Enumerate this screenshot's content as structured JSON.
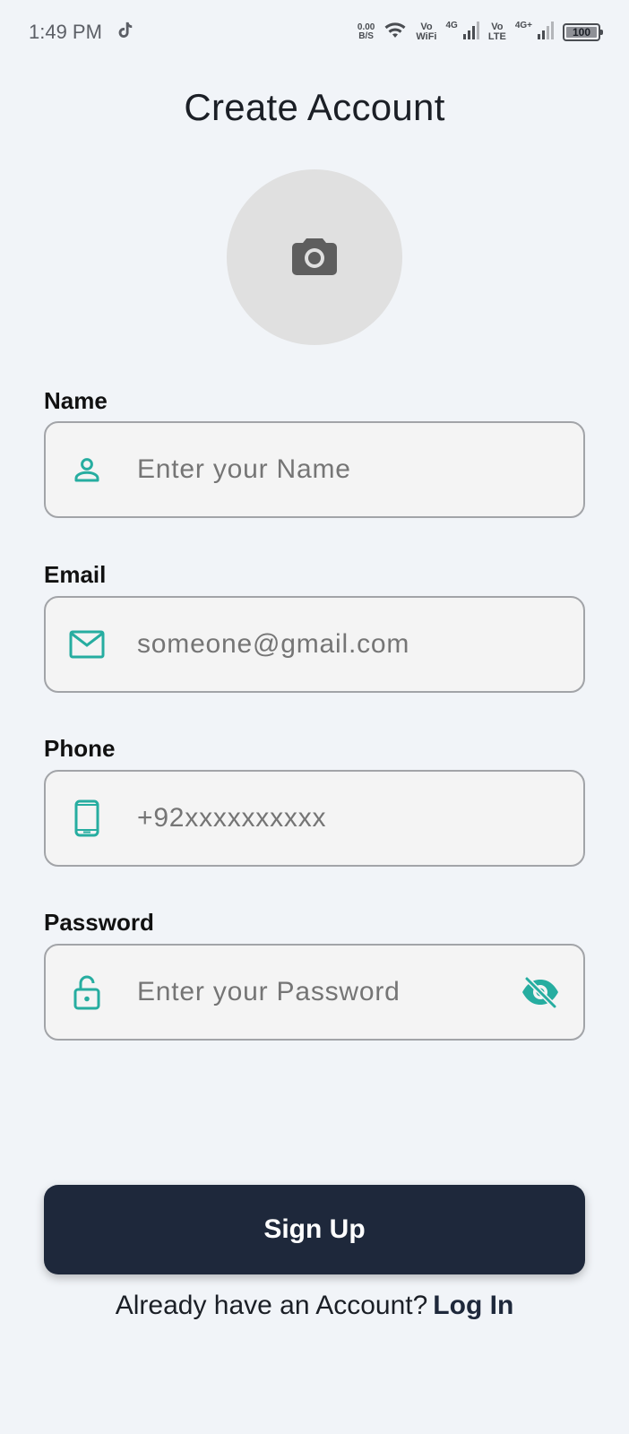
{
  "status_bar": {
    "time": "1:49 PM",
    "data_rate_value": "0.00",
    "data_rate_unit": "B/S",
    "vowifi_top": "Vo",
    "vowifi_bottom": "WiFi",
    "net1": "4G",
    "volte_top": "Vo",
    "volte_bottom": "LTE",
    "net2": "4G+",
    "battery": "100"
  },
  "page": {
    "title": "Create Account"
  },
  "fields": {
    "name": {
      "label": "Name",
      "placeholder": "Enter your Name"
    },
    "email": {
      "label": "Email",
      "placeholder": "someone@gmail.com"
    },
    "phone": {
      "label": "Phone",
      "placeholder": "+92xxxxxxxxxx"
    },
    "password": {
      "label": "Password",
      "placeholder": "Enter your Password"
    }
  },
  "actions": {
    "signup_label": "Sign Up",
    "login_prompt": "Already have an Account?",
    "login_label": "Log In"
  },
  "colors": {
    "accent": "#26ada0",
    "button_bg": "#1e283b",
    "background": "#f1f4f8"
  },
  "icons": {
    "avatar": "camera-icon",
    "name": "person-icon",
    "email": "mail-icon",
    "phone": "smartphone-icon",
    "password": "lock-open-icon",
    "visibility": "visibility-off-icon"
  }
}
